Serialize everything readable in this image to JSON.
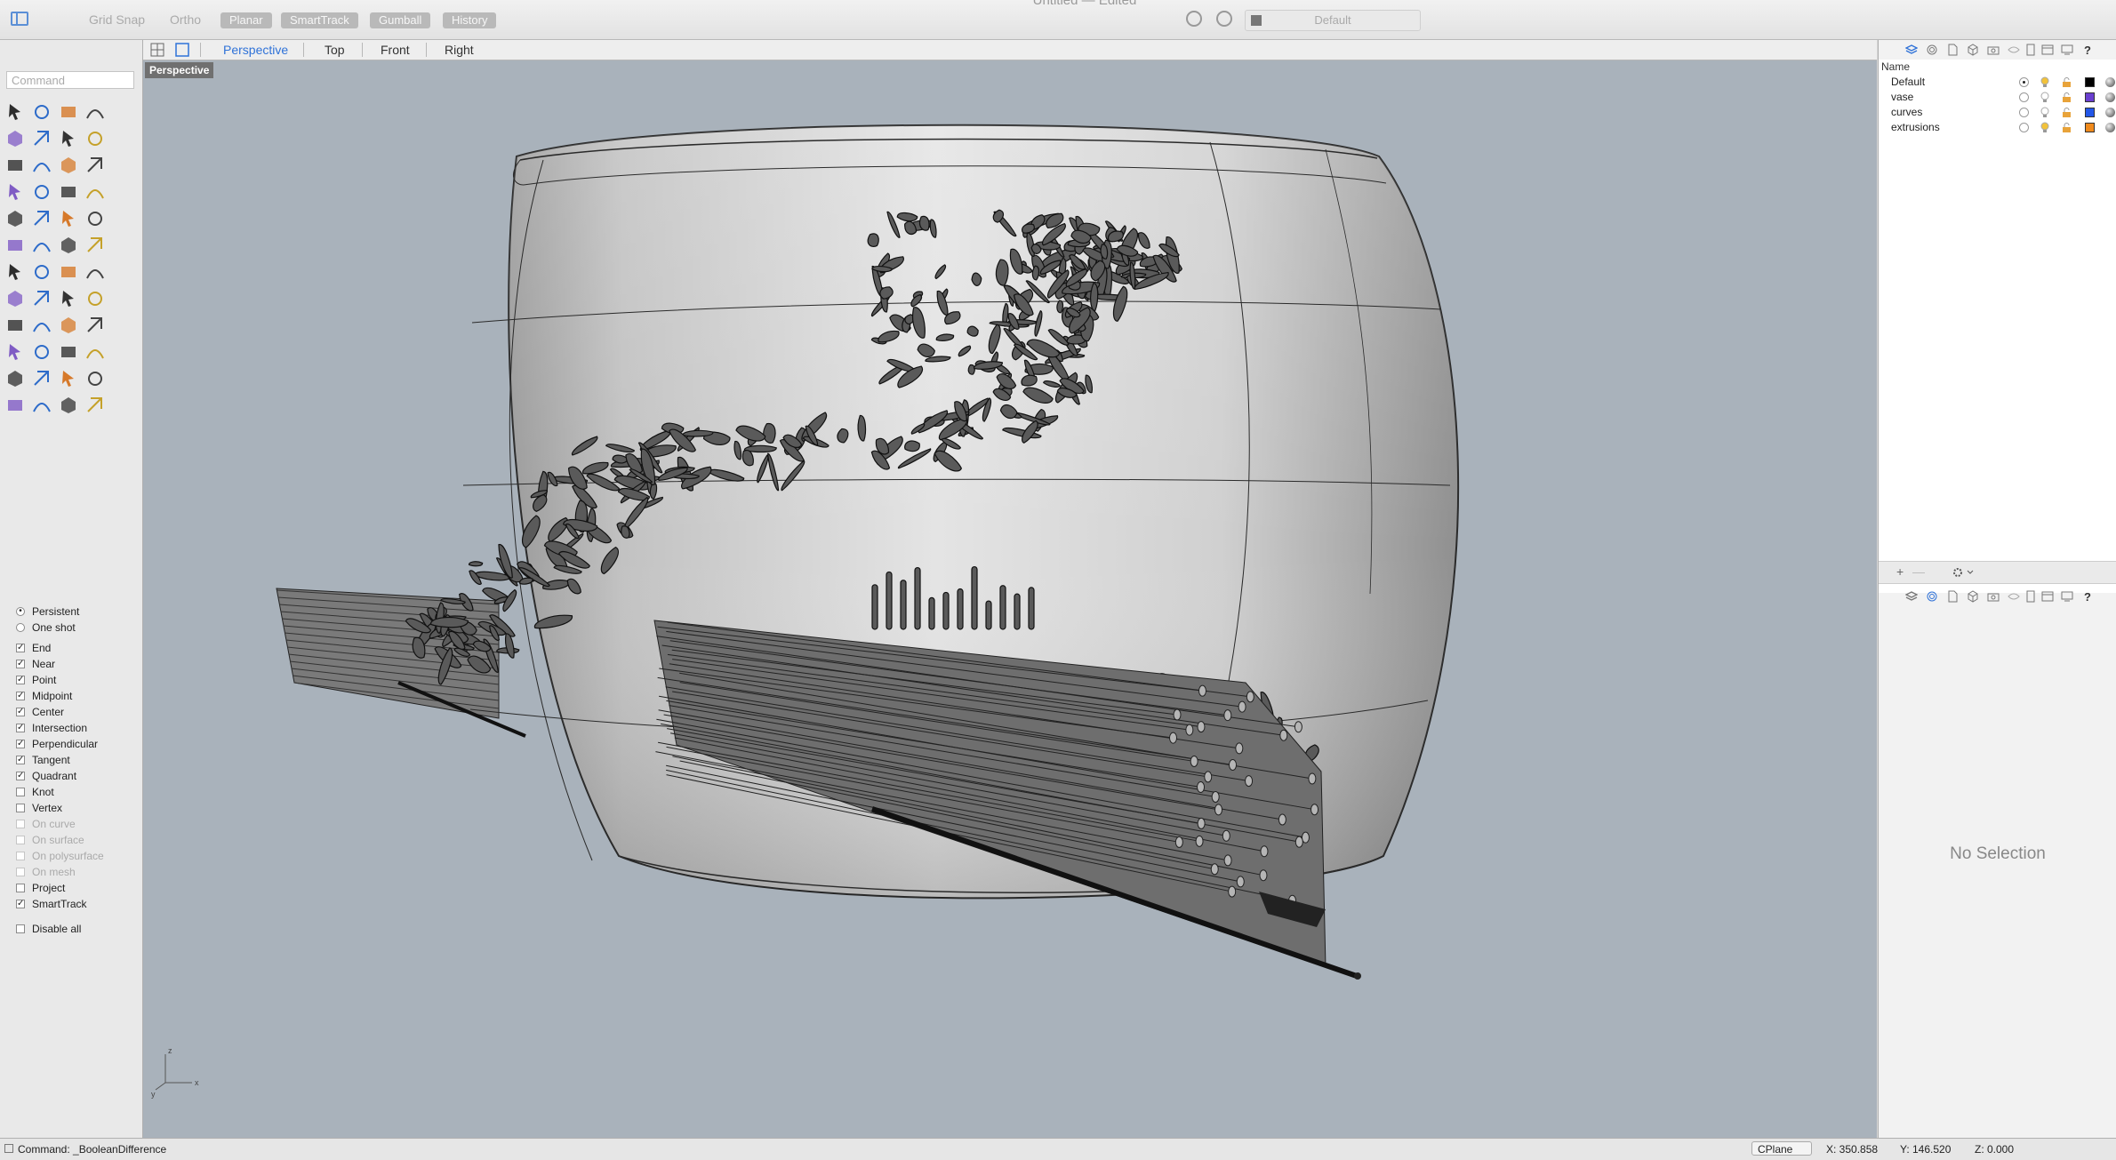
{
  "window": {
    "title": "Untitled — Edited"
  },
  "toolbar": {
    "grid_snap": "Grid Snap",
    "ortho": "Ortho",
    "planar": "Planar",
    "smarttrack": "SmartTrack",
    "gumball": "Gumball",
    "history": "History",
    "layer_combo": "Default"
  },
  "command": {
    "placeholder": "Command"
  },
  "viewport_tabs": [
    "Perspective",
    "Top",
    "Front",
    "Right"
  ],
  "active_viewport": "Perspective",
  "viewport_label": "Perspective",
  "osnap": {
    "modes": [
      {
        "label": "Persistent",
        "type": "radio",
        "checked": true
      },
      {
        "label": "One shot",
        "type": "radio",
        "checked": false
      }
    ],
    "items": [
      {
        "label": "End",
        "checked": true,
        "enabled": true
      },
      {
        "label": "Near",
        "checked": true,
        "enabled": true
      },
      {
        "label": "Point",
        "checked": true,
        "enabled": true
      },
      {
        "label": "Midpoint",
        "checked": true,
        "enabled": true
      },
      {
        "label": "Center",
        "checked": true,
        "enabled": true
      },
      {
        "label": "Intersection",
        "checked": true,
        "enabled": true
      },
      {
        "label": "Perpendicular",
        "checked": true,
        "enabled": true
      },
      {
        "label": "Tangent",
        "checked": true,
        "enabled": true
      },
      {
        "label": "Quadrant",
        "checked": true,
        "enabled": true
      },
      {
        "label": "Knot",
        "checked": false,
        "enabled": true
      },
      {
        "label": "Vertex",
        "checked": false,
        "enabled": true
      },
      {
        "label": "On curve",
        "checked": false,
        "enabled": false
      },
      {
        "label": "On surface",
        "checked": false,
        "enabled": false
      },
      {
        "label": "On polysurface",
        "checked": false,
        "enabled": false
      },
      {
        "label": "On mesh",
        "checked": false,
        "enabled": false
      },
      {
        "label": "Project",
        "checked": false,
        "enabled": true
      },
      {
        "label": "SmartTrack",
        "checked": true,
        "enabled": true
      }
    ],
    "disable_all": "Disable all"
  },
  "layers": {
    "header": "Name",
    "rows": [
      {
        "name": "Default",
        "current": true,
        "light_on": true,
        "color": "#000000"
      },
      {
        "name": "vase",
        "current": false,
        "light_on": false,
        "color": "#6a3fd0"
      },
      {
        "name": "curves",
        "current": false,
        "light_on": false,
        "color": "#2357e8"
      },
      {
        "name": "extrusions",
        "current": false,
        "light_on": true,
        "color": "#f08a1c"
      }
    ],
    "footer_add": "+",
    "footer_remove": "—"
  },
  "properties": {
    "empty_text": "No Selection"
  },
  "status": {
    "command": "Command: _BooleanDifference",
    "cplane": "CPlane",
    "x": "X: 350.858",
    "y": "Y: 146.520",
    "z": "Z: 0.000"
  },
  "axis": {
    "x": "x",
    "y": "y",
    "z": "z"
  },
  "colors": {
    "accent": "#2f72d8",
    "viewport_bg": "#a9b2bb",
    "vase": "#c9c9c9"
  }
}
